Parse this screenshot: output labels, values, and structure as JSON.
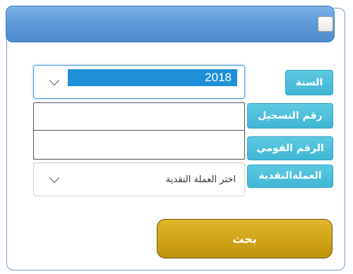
{
  "form": {
    "year_label": "السنة",
    "year_value": "2018",
    "registration_label": "رقم التسجيل",
    "registration_value": "",
    "national_id_label": "الرقم القومي",
    "national_id_value": "",
    "currency_label": "العملةالنقدية",
    "currency_placeholder": "اختر العملة النقدية",
    "search_label": "بحث"
  },
  "colors": {
    "title_bar": "#5f9bd8",
    "label_bg": "#4ec0db",
    "search_button": "#d4a81c",
    "selection_highlight": "#1e90d8"
  },
  "icons": [
    "chevron-down-icon"
  ]
}
